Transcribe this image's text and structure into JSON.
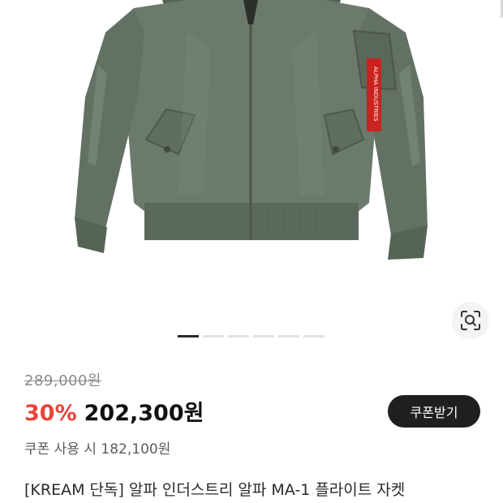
{
  "product": {
    "image_alt": "MA-1 flight jacket",
    "patch_text": "ALPHA INDUSTRIES",
    "gallery_total": 6,
    "gallery_current": 1,
    "colors": {
      "jacket": "#6b7a6c",
      "jacket_shadow": "#566456",
      "jacket_highlight": "#7f8e80",
      "tag": "#c8231f"
    }
  },
  "price": {
    "original": "289,000원",
    "discount_rate": "30%",
    "sale": "202,300원",
    "coupon_label": "쿠폰 사용 시 182,100원",
    "coupon_button": "쿠폰받기",
    "discount_color": "#e8453c"
  },
  "title": "[KREAM 단독] 알파 인더스트리 알파 MA-1 플라이트 자켓"
}
